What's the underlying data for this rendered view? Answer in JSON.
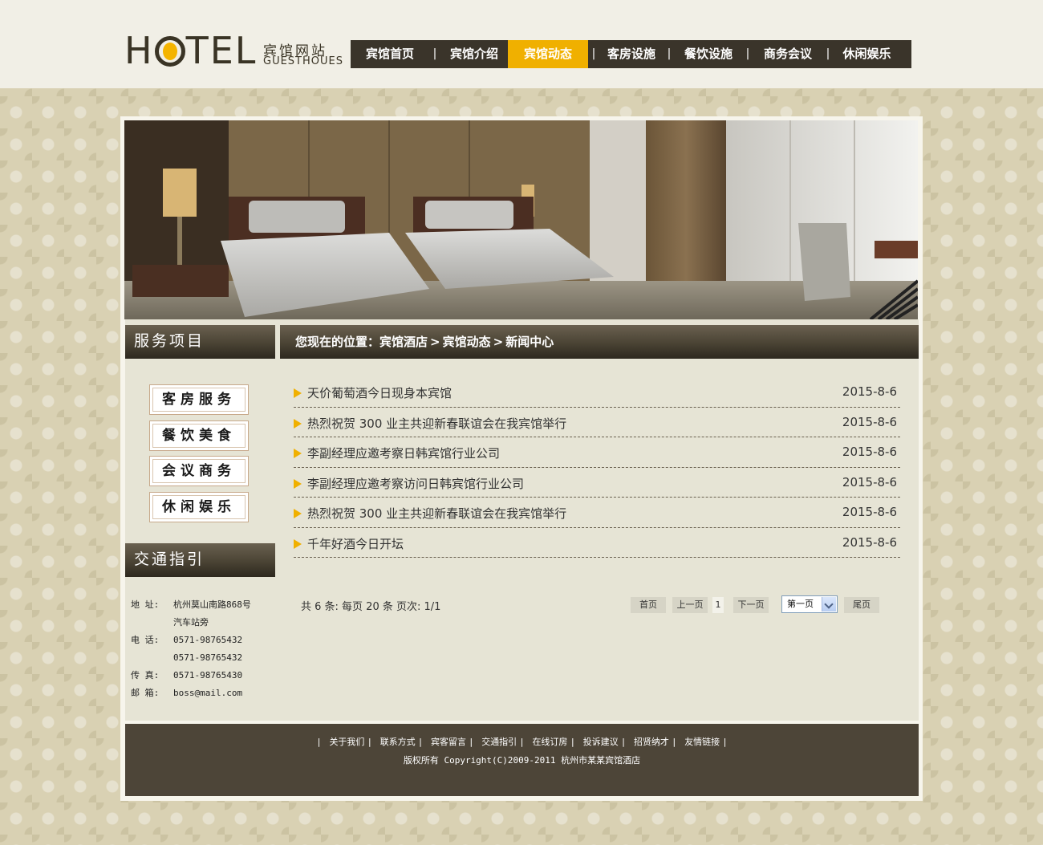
{
  "logo": {
    "brand": "HOTEL",
    "cn_title": "宾馆网站",
    "en_subtitle": "GUESTHOUES"
  },
  "nav": {
    "items": [
      {
        "label": "宾馆首页"
      },
      {
        "label": "宾馆介绍"
      },
      {
        "label": "宾馆动态",
        "active": true
      },
      {
        "label": "客房设施"
      },
      {
        "label": "餐饮设施"
      },
      {
        "label": "商务会议"
      },
      {
        "label": "休闲娱乐"
      }
    ],
    "separator": "|"
  },
  "sidebar": {
    "services_heading": "服务项目",
    "services": [
      {
        "label": "客房服务"
      },
      {
        "label": "餐饮美食"
      },
      {
        "label": "会议商务"
      },
      {
        "label": "休闲娱乐"
      }
    ],
    "traffic_heading": "交通指引",
    "contact": {
      "address_label": "地  址:",
      "address_line1": "杭州莫山南路868号",
      "address_line2": "汽车站旁",
      "phone_label": "电  话:",
      "phone_1": "0571-98765432",
      "phone_2": "0571-98765432",
      "fax_label": "传  真:",
      "fax": "0571-98765430",
      "email_label": "邮  箱:",
      "email": "boss@mail.com"
    }
  },
  "breadcrumb": {
    "prefix": "您现在的位置：",
    "items": [
      "宾馆酒店",
      "宾馆动态",
      "新闻中心"
    ],
    "separator": ">"
  },
  "news": [
    {
      "title": "天价葡萄酒今日现身本宾馆",
      "date": "2015-8-6"
    },
    {
      "title": "热烈祝贺 300 业主共迎新春联谊会在我宾馆举行",
      "date": "2015-8-6"
    },
    {
      "title": "李副经理应邀考察日韩宾馆行业公司",
      "date": "2015-8-6"
    },
    {
      "title": "李副经理应邀考察访问日韩宾馆行业公司",
      "date": "2015-8-6"
    },
    {
      "title": "热烈祝贺 300 业主共迎新春联谊会在我宾馆举行",
      "date": "2015-8-6"
    },
    {
      "title": "千年好酒今日开坛",
      "date": "2015-8-6"
    }
  ],
  "pager": {
    "summary": "共 6 条:  每页 20 条 页次:  1/1",
    "first": "首页",
    "prev": "上一页",
    "current": "1",
    "next": "下一页",
    "select_value": "第一页",
    "last": "尾页"
  },
  "footer": {
    "links": [
      "关于我们",
      "联系方式",
      "宾客留言",
      "交通指引",
      "在线订房",
      "投诉建议",
      "招贤纳才",
      "友情链接"
    ],
    "separator": "|",
    "copyright": "版权所有 Copyright(C)2009-2011 杭州市某某宾馆酒店"
  },
  "colors": {
    "nav_bg": "#3a342a",
    "accent": "#f0b000",
    "header_bar": "#4a4334",
    "footer_bg": "#4d4538"
  }
}
